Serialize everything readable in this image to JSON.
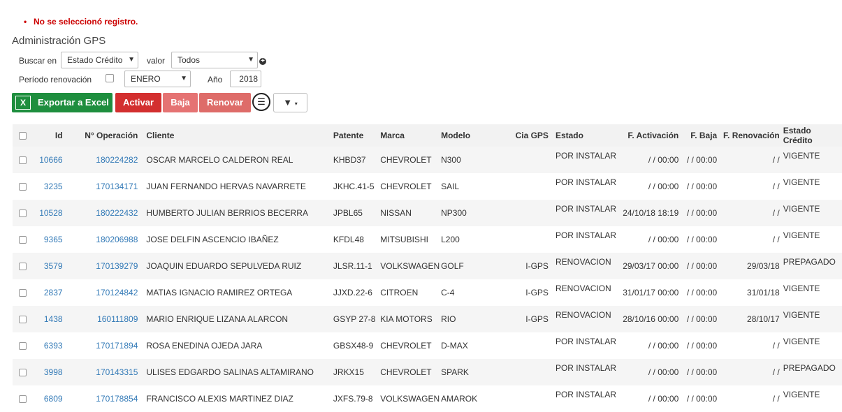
{
  "alert": "No se seleccionó registro.",
  "page_title": "Administración GPS",
  "filters": {
    "buscar_label": "Buscar en",
    "buscar_value": "Estado Crédito",
    "valor_label": "valor",
    "valor_value": "Todos",
    "periodo_label": "Período renovación",
    "mes_value": "ENERO",
    "anio_label": "Año",
    "anio_value": "2018"
  },
  "toolbar": {
    "exportar": "Exportar a Excel",
    "activar": "Activar",
    "baja": "Baja",
    "renovar": "Renovar"
  },
  "columns": [
    "Id",
    "N° Operación",
    "Cliente",
    "Patente",
    "Marca",
    "Modelo",
    "Cia GPS",
    "Estado",
    "F. Activación",
    "F. Baja",
    "F. Renovación",
    "Estado Crédito"
  ],
  "rows": [
    [
      "10666",
      "180224282",
      "OSCAR MARCELO CALDERON REAL",
      "KHBD37",
      "CHEVROLET",
      "N300",
      "",
      "POR INSTALAR",
      "/ / 00:00",
      "/ / 00:00",
      "/ /",
      "VIGENTE"
    ],
    [
      "3235",
      "170134171",
      "JUAN FERNANDO HERVAS NAVARRETE",
      "JKHC.41-5",
      "CHEVROLET",
      "SAIL",
      "",
      "POR INSTALAR",
      "/ / 00:00",
      "/ / 00:00",
      "/ /",
      "VIGENTE"
    ],
    [
      "10528",
      "180222432",
      "HUMBERTO JULIAN BERRIOS BECERRA",
      "JPBL65",
      "NISSAN",
      "NP300",
      "",
      "POR INSTALAR",
      "24/10/18 18:19",
      "/ / 00:00",
      "/ /",
      "VIGENTE"
    ],
    [
      "9365",
      "180206988",
      "JOSE DELFIN ASCENCIO IBAÑEZ",
      "KFDL48",
      "MITSUBISHI",
      "L200",
      "",
      "POR INSTALAR",
      "/ / 00:00",
      "/ / 00:00",
      "/ /",
      "VIGENTE"
    ],
    [
      "3579",
      "170139279",
      "JOAQUIN EDUARDO SEPULVEDA RUIZ",
      "JLSR.11-1",
      "VOLKSWAGEN",
      "GOLF",
      "I-GPS",
      "RENOVACION",
      "29/03/17 00:00",
      "/ / 00:00",
      "29/03/18",
      "PREPAGADO"
    ],
    [
      "2837",
      "170124842",
      "MATIAS IGNACIO RAMIREZ ORTEGA",
      "JJXD.22-6",
      "CITROEN",
      "C-4",
      "I-GPS",
      "RENOVACION",
      "31/01/17 00:00",
      "/ / 00:00",
      "31/01/18",
      "VIGENTE"
    ],
    [
      "1438",
      "160111809",
      "MARIO ENRIQUE LIZANA ALARCON",
      "GSYP 27-8",
      "KIA MOTORS",
      "RIO",
      "I-GPS",
      "RENOVACION",
      "28/10/16 00:00",
      "/ / 00:00",
      "28/10/17",
      "VIGENTE"
    ],
    [
      "6393",
      "170171894",
      "ROSA ENEDINA OJEDA JARA",
      "GBSX48-9",
      "CHEVROLET",
      "D-MAX",
      "",
      "POR INSTALAR",
      "/ / 00:00",
      "/ / 00:00",
      "/ /",
      "VIGENTE"
    ],
    [
      "3998",
      "170143315",
      "ULISES EDGARDO SALINAS ALTAMIRANO",
      "JRKX15",
      "CHEVROLET",
      "SPARK",
      "",
      "POR INSTALAR",
      "/ / 00:00",
      "/ / 00:00",
      "/ /",
      "PREPAGADO"
    ],
    [
      "6809",
      "170178854",
      "FRANCISCO ALEXIS MARTINEZ DIAZ",
      "JXFS.79-8",
      "VOLKSWAGEN",
      "AMAROK",
      "",
      "POR INSTALAR",
      "/ / 00:00",
      "/ / 00:00",
      "/ /",
      "VIGENTE"
    ]
  ]
}
